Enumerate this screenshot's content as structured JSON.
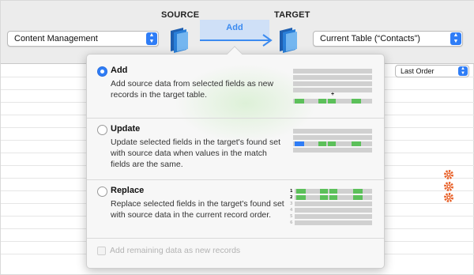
{
  "header": {
    "source_label": "SOURCE",
    "target_label": "TARGET",
    "source_popup": "Content Management",
    "target_popup": "Current Table (“Contacts”)",
    "import_mode": "Add"
  },
  "background": {
    "sort_popup": "Last Order",
    "icons": [
      "gear-icon",
      "gear-icon",
      "gear-icon"
    ]
  },
  "panel": {
    "options": [
      {
        "title": "Add",
        "description": "Add source data from selected fields as new records in the target table.",
        "selected": true
      },
      {
        "title": "Update",
        "description": "Update selected fields in the target's found set with source data when values in the match fields are the same.",
        "selected": false
      },
      {
        "title": "Replace",
        "description": "Replace selected fields in the target's found set with source data in the current record order.",
        "selected": false
      }
    ],
    "diagrams": {
      "add_plus": "+",
      "replace_rows": [
        "1",
        "2",
        "3",
        "4",
        "5",
        "6"
      ]
    },
    "checkbox": {
      "label": "Add remaining data as new records",
      "checked": false,
      "enabled": false
    }
  },
  "colors": {
    "accent": "#2f7df6",
    "match_green": "#5cc05a",
    "gear_orange": "#e8622a"
  }
}
